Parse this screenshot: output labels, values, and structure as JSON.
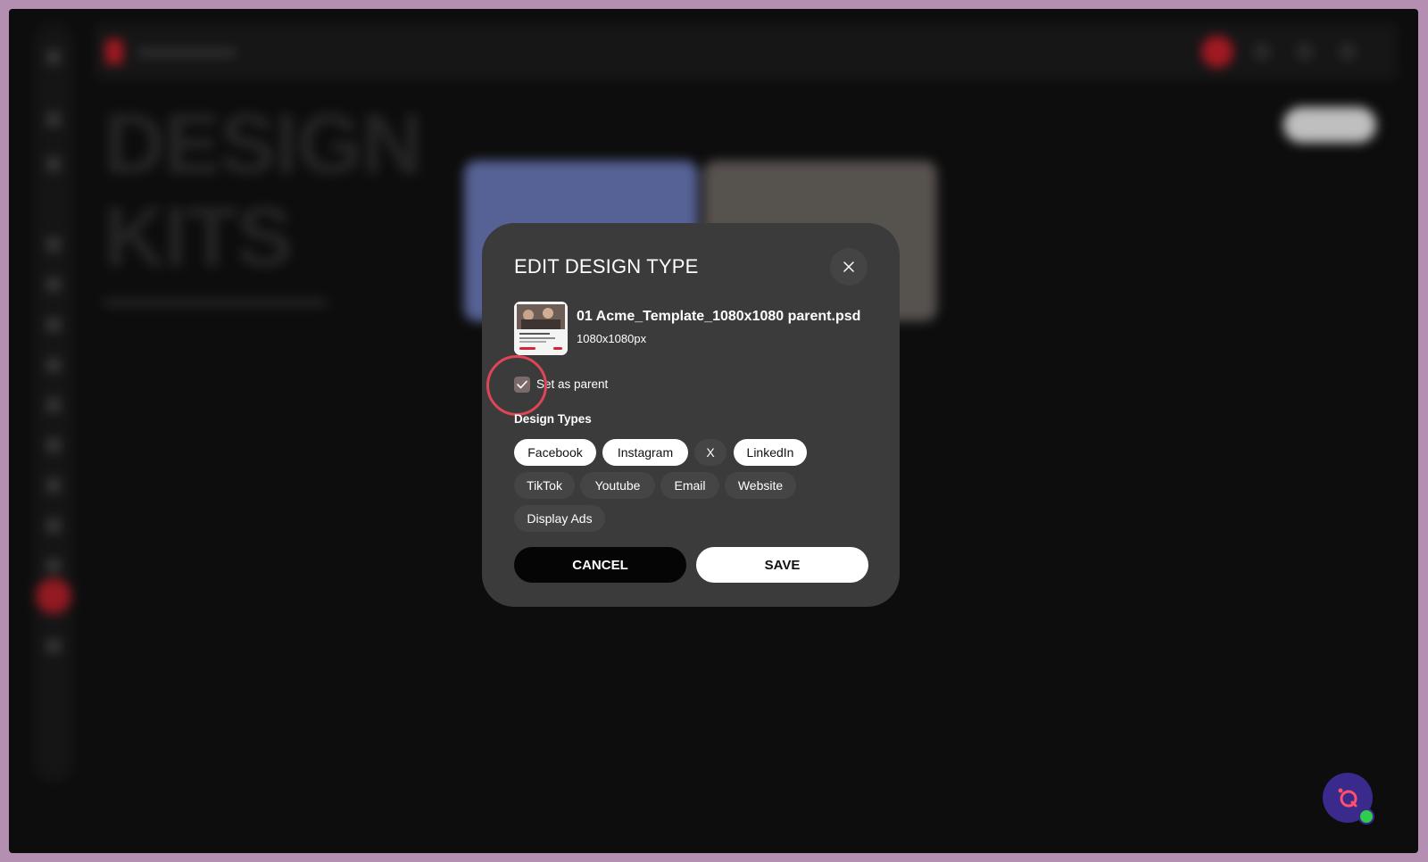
{
  "background_app": {
    "page_title_line1": "DESIGN",
    "page_title_line2": "KITS"
  },
  "modal": {
    "title": "EDIT DESIGN TYPE",
    "close_icon": "close-icon",
    "file": {
      "name": "01 Acme_Template_1080x1080 parent.psd",
      "dimensions": "1080x1080px"
    },
    "set_as_parent": {
      "label": "Set as parent",
      "checked": true
    },
    "design_types_label": "Design Types",
    "design_types": [
      {
        "label": "Facebook",
        "selected": true
      },
      {
        "label": "Instagram",
        "selected": true
      },
      {
        "label": "X",
        "selected": false
      },
      {
        "label": "LinkedIn",
        "selected": true
      },
      {
        "label": "TikTok",
        "selected": false
      },
      {
        "label": "Youtube",
        "selected": false
      },
      {
        "label": "Email",
        "selected": false
      },
      {
        "label": "Website",
        "selected": false
      },
      {
        "label": "Display Ads",
        "selected": false
      }
    ],
    "cancel_label": "CANCEL",
    "save_label": "SAVE"
  },
  "colors": {
    "accent_red": "#c51f2a",
    "highlight_ring": "#e04457",
    "modal_bg": "#3b3b3b",
    "chat_launcher": "#3a2a8c",
    "online_status": "#2fcc4f"
  }
}
